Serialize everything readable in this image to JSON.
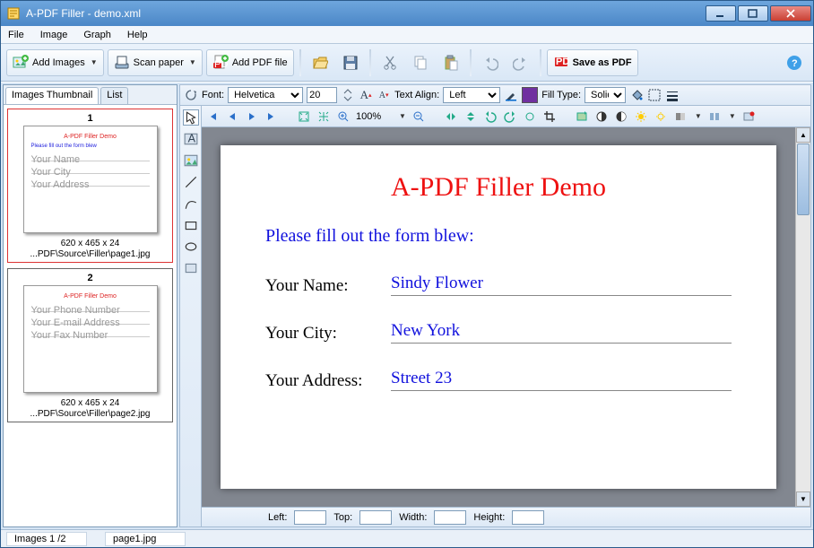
{
  "title": "A-PDF Filler - demo.xml",
  "menu": {
    "file": "File",
    "image": "Image",
    "graph": "Graph",
    "help": "Help"
  },
  "toolbar": {
    "add_images": "Add Images",
    "scan_paper": "Scan paper",
    "add_pdf": "Add PDF file",
    "save_as_pdf": "Save as PDF"
  },
  "left": {
    "tab_thumb": "Images Thumbnail",
    "tab_list": "List",
    "thumbs": [
      {
        "num": "1",
        "dims": "620 x 465 x 24",
        "path": "...PDF\\Source\\Filler\\page1.jpg",
        "selected": true
      },
      {
        "num": "2",
        "dims": "620 x 465 x 24",
        "path": "...PDF\\Source\\Filler\\page2.jpg",
        "selected": false
      }
    ]
  },
  "fmt": {
    "font_label": "Font:",
    "font_value": "Helvetica",
    "size_value": "20",
    "align_label": "Text Align:",
    "align_value": "Left",
    "fill_label": "Fill Type:",
    "fill_value": "Solid"
  },
  "zoom": {
    "value": "100%"
  },
  "document": {
    "title": "A-PDF Filler Demo",
    "subtitle": "Please fill out the form blew:",
    "rows": [
      {
        "label": "Your Name:",
        "value": "Sindy Flower"
      },
      {
        "label": "Your City:",
        "value": "New York"
      },
      {
        "label": "Your Address:",
        "value": "Street 23"
      }
    ]
  },
  "pos": {
    "left": "Left:",
    "top": "Top:",
    "width": "Width:",
    "height": "Height:"
  },
  "status": {
    "pages": "Images 1 /2",
    "file": "page1.jpg"
  }
}
